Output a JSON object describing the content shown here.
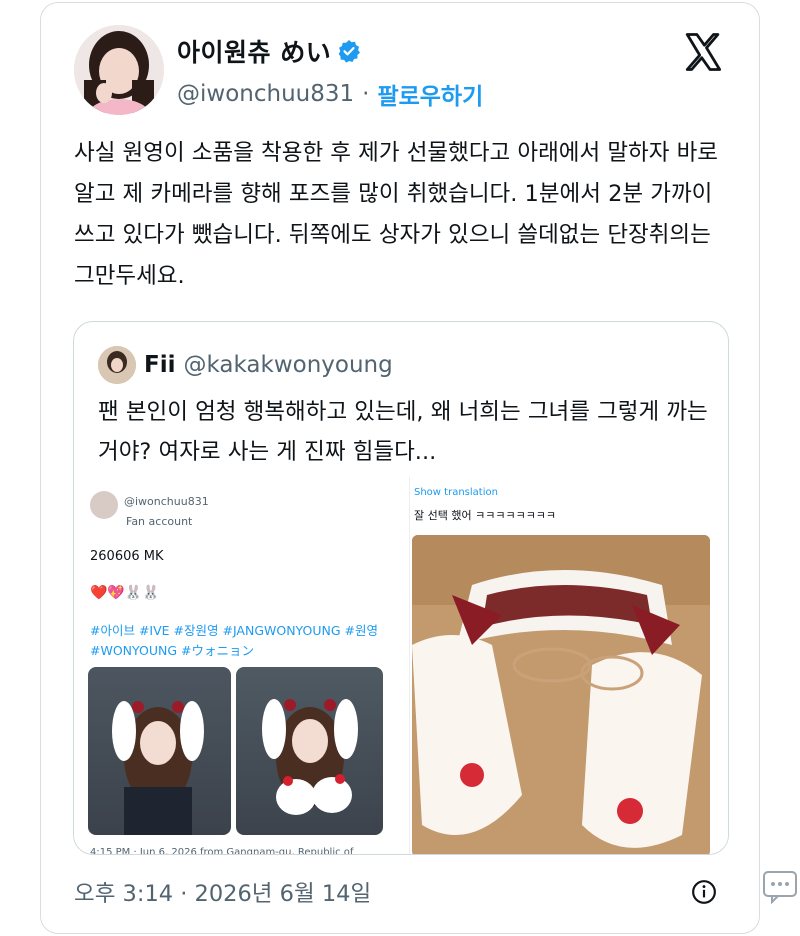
{
  "tweet": {
    "author_name": "아이원츄 めい",
    "handle": "@iwonchuu831",
    "separator": "·",
    "follow_label": "팔로우하기",
    "text": "사실 원영이 소품을 착용한 후 제가 선물했다고 아래에서 말하자 바로 알고 제 카메라를 향해 포즈를 많이 취했습니다. 1분에서 2분 가까이 쓰고 있다가 뺐습니다. 뒤쪽에도 상자가 있으니 쓸데없는 단장취의는 그만두세요.",
    "timestamp": "오후 3:14 · 2026년 6월 14일"
  },
  "quote": {
    "name": "Fii",
    "handle": "@kakakwonyoung",
    "text": "팬 본인이 엄청 행복해하고 있는데, 왜 너희는 그녀를 그렇게 까는 거야? 여자로 사는 게 진짜 힘들다...",
    "left_image": {
      "handle": "@iwonchuu831",
      "badge": "Fan account",
      "caption": "260606 MK",
      "emojis": "❤️💖🐰🐰",
      "tags": "#아이브 #IVE #장원영 #JANGWONYOUNG #원영 #WONYOUNG #ウォニョン",
      "footer": "4:15 PM · Jun 6, 2026 from Gangnam-gu, Republic of"
    },
    "right_image": {
      "show_translation": "Show translation",
      "text": "잘 선택 했어 ㅋㅋㅋㅋㅋㅋㅋㅋ"
    }
  },
  "colors": {
    "accent": "#1d9bf0",
    "secondary_text": "#536471",
    "border": "#cfd9de"
  },
  "icons": [
    "verified-icon",
    "x-logo-icon",
    "info-icon",
    "more-icon"
  ]
}
